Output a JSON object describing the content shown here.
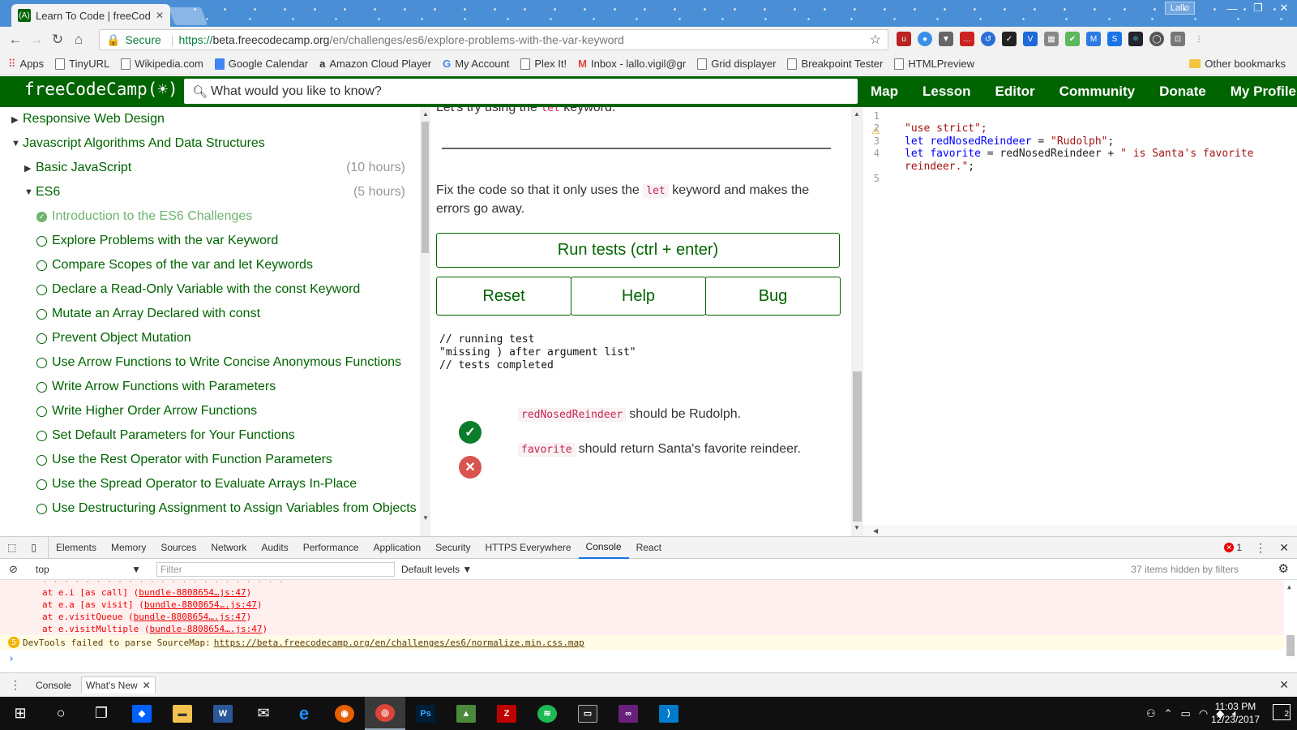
{
  "browser": {
    "tab_title": "Learn To Code | freeCode",
    "tab_favicon": "(A)",
    "user_label": "Lallo",
    "secure_label": "Secure",
    "url_scheme": "https://",
    "url_host": "beta.freecodecamp.org",
    "url_path": "/en/challenges/es6/explore-problems-with-the-var-keyword"
  },
  "bookmarks": [
    "Apps",
    "TinyURL",
    "Wikipedia.com",
    "Google Calendar",
    "Amazon Cloud Player",
    "My Account",
    "Plex It!",
    "Inbox - lallo.vigil@gr",
    "Grid displayer",
    "Breakpoint Tester",
    "HTMLPreview"
  ],
  "other_bookmarks": "Other bookmarks",
  "fcc": {
    "logo": "freeCodeCamp(☀)",
    "search_placeholder": "What would you like to know?",
    "nav": [
      "Map",
      "Lesson",
      "Editor",
      "Community",
      "Donate",
      "My Profile"
    ]
  },
  "sidebar": {
    "sections": [
      {
        "label": "Responsive Web Design"
      },
      {
        "label": "Javascript Algorithms And Data Structures"
      }
    ],
    "basic_js": {
      "label": "Basic JavaScript",
      "hours": "(10 hours)"
    },
    "es6": {
      "label": "ES6",
      "hours": "(5 hours)"
    },
    "challenges": [
      {
        "label": "Introduction to the ES6 Challenges",
        "done": true
      },
      {
        "label": "Explore Problems with the var Keyword"
      },
      {
        "label": "Compare Scopes of the var and let Keywords"
      },
      {
        "label": "Declare a Read-Only Variable with the const Keyword"
      },
      {
        "label": "Mutate an Array Declared with const"
      },
      {
        "label": "Prevent Object Mutation"
      },
      {
        "label": "Use Arrow Functions to Write Concise Anonymous Functions"
      },
      {
        "label": "Write Arrow Functions with Parameters"
      },
      {
        "label": "Write Higher Order Arrow Functions"
      },
      {
        "label": "Set Default Parameters for Your Functions"
      },
      {
        "label": "Use the Rest Operator with Function Parameters"
      },
      {
        "label": "Use the Spread Operator to Evaluate Arrays In-Place"
      },
      {
        "label": "Use Destructuring Assignment to Assign Variables from Objects"
      }
    ]
  },
  "challenge": {
    "cut_text_before": "Let's try using the",
    "cut_code": "let",
    "cut_text_after": "keyword.",
    "instr_before": "Fix the code so that it only uses the",
    "instr_code": "let",
    "instr_after": "keyword and makes the errors go away.",
    "run_button": "Run tests (ctrl + enter)",
    "reset_button": "Reset",
    "help_button": "Help",
    "bug_button": "Bug",
    "output_lines": [
      "// running test",
      "\"missing ) after argument list\"",
      "// tests completed"
    ],
    "tests": [
      {
        "code": "redNosedReindeer",
        "text": "should be Rudolph.",
        "pass": true
      },
      {
        "code": "favorite",
        "text": "should return Santa's favorite reindeer.",
        "pass": false
      }
    ]
  },
  "editor": {
    "line_numbers": [
      "1",
      "2",
      "3",
      "4",
      "",
      "5"
    ],
    "line2": "\"use strict\";",
    "line3_kw": "let",
    "line3_var": "redNosedReindeer",
    "line3_op": " = ",
    "line3_str": "\"Rudolph\"",
    "line3_end": ";",
    "line4_kw": "let",
    "line4_var": "favorite",
    "line4_mid": " = redNosedReindeer + ",
    "line4_str": "\" is Santa's favorite",
    "line4b_str": "reindeer.\"",
    "line4b_end": ";"
  },
  "devtools": {
    "tabs": [
      "Elements",
      "Memory",
      "Sources",
      "Network",
      "Audits",
      "Performance",
      "Application",
      "Security",
      "HTTPS Everywhere",
      "Console",
      "React"
    ],
    "active_tab": "Console",
    "error_count": "1",
    "context": "top",
    "filter_placeholder": "Filter",
    "levels": "Default levels",
    "hidden": "37 items hidden by filters",
    "stack": [
      {
        "fn": "at e.i [as call] (",
        "link": "bundle-8808654…js:47",
        "end": ")"
      },
      {
        "fn": "at e.a [as visit] (",
        "link": "bundle-8808654….js:47",
        "end": ")"
      },
      {
        "fn": "at e.visitQueue (",
        "link": "bundle-8808654….js:47",
        "end": ")"
      },
      {
        "fn": "at e.visitMultiple (",
        "link": "bundle-8808654….js:47",
        "end": ")"
      }
    ],
    "warning_count": "5",
    "warning_text": "DevTools failed to parse SourceMap:",
    "warning_link": "https://beta.freecodecamp.org/en/challenges/es6/normalize.min.css.map",
    "drawer_tabs": [
      "Console",
      "What's New"
    ]
  },
  "taskbar": {
    "time": "11:03 PM",
    "date": "12/23/2017",
    "notif_count": "2"
  },
  "colors": {
    "fcc_green": "#006400",
    "error_red": "#e00",
    "pass_green": "#0a7d2c",
    "fail_red": "#d9534f"
  }
}
